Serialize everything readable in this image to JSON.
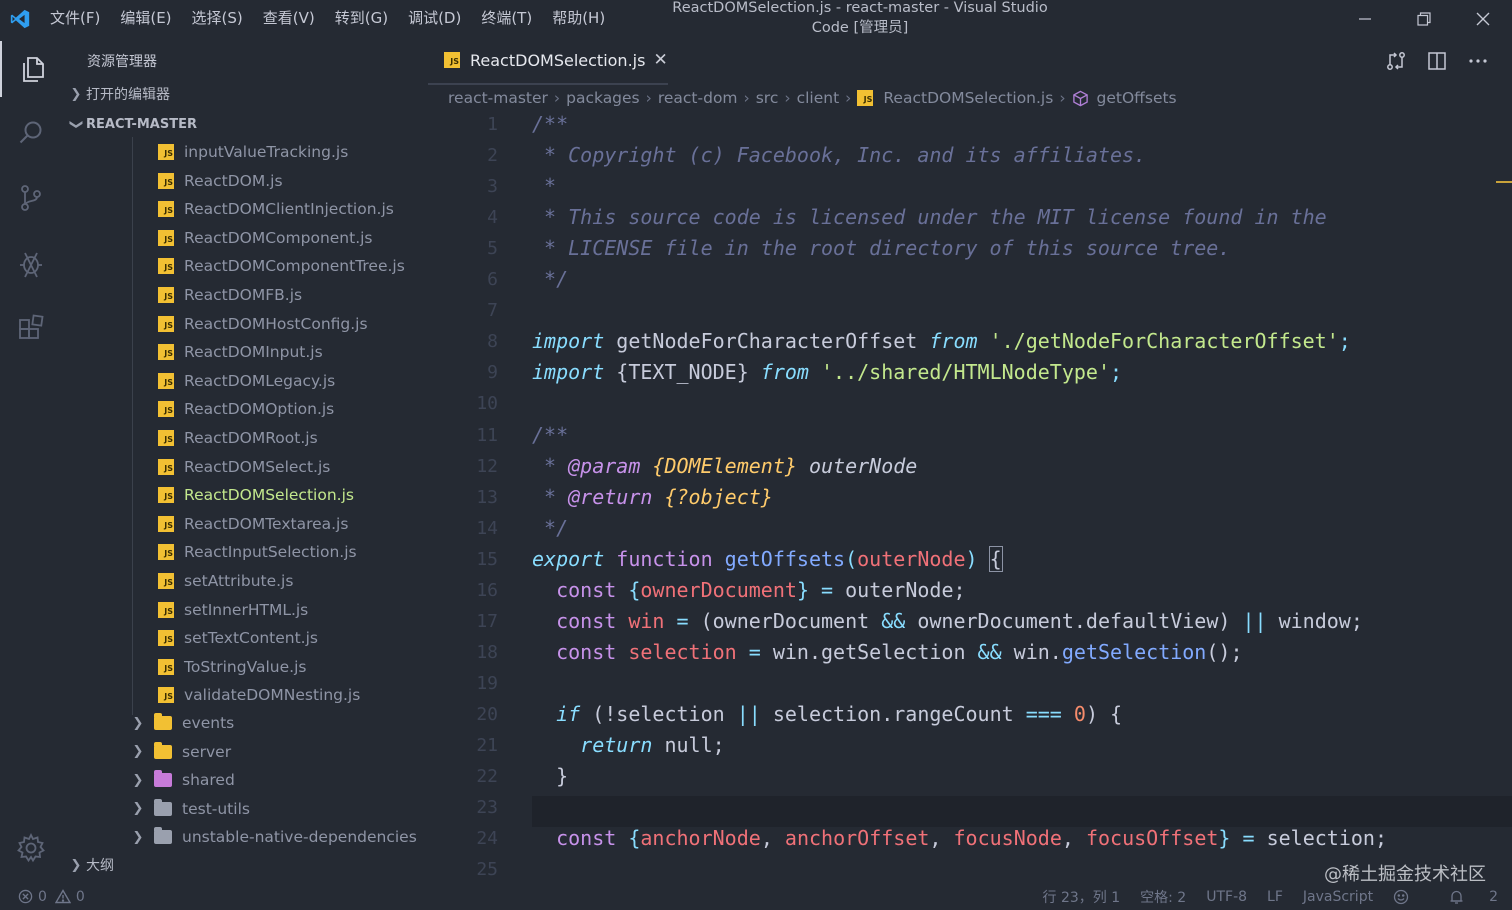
{
  "titlebar": {
    "menu": [
      "文件(F)",
      "编辑(E)",
      "选择(S)",
      "查看(V)",
      "转到(G)",
      "调试(D)",
      "终端(T)",
      "帮助(H)"
    ],
    "title": "ReactDOMSelection.js - react-master - Visual Studio Code [管理员]"
  },
  "activity_bar": [
    "explorer-icon",
    "search-icon",
    "source-control-icon",
    "debug-icon",
    "extensions-icon",
    "settings-gear-icon"
  ],
  "sidebar": {
    "heading": "资源管理器",
    "open_editors": "打开的编辑器",
    "project": "REACT-MASTER",
    "outline": "大纲",
    "files": [
      "inputValueTracking.js",
      "ReactDOM.js",
      "ReactDOMClientInjection.js",
      "ReactDOMComponent.js",
      "ReactDOMComponentTree.js",
      "ReactDOMFB.js",
      "ReactDOMHostConfig.js",
      "ReactDOMInput.js",
      "ReactDOMLegacy.js",
      "ReactDOMOption.js",
      "ReactDOMRoot.js",
      "ReactDOMSelect.js",
      "ReactDOMSelection.js",
      "ReactDOMTextarea.js",
      "ReactInputSelection.js",
      "setAttribute.js",
      "setInnerHTML.js",
      "setTextContent.js",
      "ToStringValue.js",
      "validateDOMNesting.js"
    ],
    "selected_file": "ReactDOMSelection.js",
    "folders": [
      {
        "name": "events",
        "color": "#f2c033"
      },
      {
        "name": "server",
        "color": "#f2c033"
      },
      {
        "name": "shared",
        "color": "#c77bd9"
      },
      {
        "name": "test-utils",
        "color": "#9aa0ae"
      },
      {
        "name": "unstable-native-dependencies",
        "color": "#9aa0ae"
      }
    ]
  },
  "tab": {
    "icon_label": "JS",
    "label": "ReactDOMSelection.js",
    "close": "✕"
  },
  "breadcrumb": [
    "react-master",
    "packages",
    "react-dom",
    "src",
    "client",
    "ReactDOMSelection.js",
    "getOffsets"
  ],
  "editor": {
    "line_numbers": [
      "1",
      "2",
      "3",
      "4",
      "5",
      "6",
      "7",
      "8",
      "9",
      "10",
      "11",
      "12",
      "13",
      "14",
      "15",
      "16",
      "17",
      "18",
      "19",
      "20",
      "21",
      "22",
      "23",
      "24",
      "25"
    ],
    "lines": [
      [
        {
          "t": "/**",
          "c": "com"
        }
      ],
      [
        {
          "t": " * Copyright (c) Facebook, Inc. and its affiliates.",
          "c": "com"
        }
      ],
      [
        {
          "t": " *",
          "c": "com"
        }
      ],
      [
        {
          "t": " * This source code is licensed under the MIT license found in the",
          "c": "com"
        }
      ],
      [
        {
          "t": " * LICENSE file in the root directory of this source tree.",
          "c": "com"
        }
      ],
      [
        {
          "t": " */",
          "c": "com"
        }
      ],
      [],
      [
        {
          "t": "import",
          "c": "kwi"
        },
        {
          "t": " getNodeForCharacterOffset ",
          "c": "txt"
        },
        {
          "t": "from",
          "c": "kwi"
        },
        {
          "t": " ",
          "c": "txt"
        },
        {
          "t": "'./getNodeForCharacterOffset'",
          "c": "str"
        },
        {
          "t": ";",
          "c": "kw"
        }
      ],
      [
        {
          "t": "import",
          "c": "kwi"
        },
        {
          "t": " {TEXT_NODE} ",
          "c": "txt"
        },
        {
          "t": "from",
          "c": "kwi"
        },
        {
          "t": " ",
          "c": "txt"
        },
        {
          "t": "'../shared/HTMLNodeType'",
          "c": "str"
        },
        {
          "t": ";",
          "c": "kw"
        }
      ],
      [],
      [
        {
          "t": "/**",
          "c": "com"
        }
      ],
      [
        {
          "t": " * ",
          "c": "com"
        },
        {
          "t": "@param",
          "c": "tag"
        },
        {
          "t": " ",
          "c": "com"
        },
        {
          "t": "{DOMElement}",
          "c": "typ"
        },
        {
          "t": " outerNode",
          "c": "txtital"
        }
      ],
      [
        {
          "t": " * ",
          "c": "com"
        },
        {
          "t": "@return",
          "c": "tag"
        },
        {
          "t": " ",
          "c": "com"
        },
        {
          "t": "{?object}",
          "c": "typ"
        }
      ],
      [
        {
          "t": " */",
          "c": "com"
        }
      ],
      [
        {
          "t": "export",
          "c": "kwi"
        },
        {
          "t": " ",
          "c": "txt"
        },
        {
          "t": "function",
          "c": "tag2"
        },
        {
          "t": " ",
          "c": "txt"
        },
        {
          "t": "getOffsets",
          "c": "fn"
        },
        {
          "t": "(",
          "c": "kw"
        },
        {
          "t": "outerNode",
          "c": "par"
        },
        {
          "t": ")",
          "c": "kw"
        },
        {
          "t": " ",
          "c": "txt"
        },
        {
          "t": "{",
          "c": "brace"
        }
      ],
      [
        {
          "t": "  const",
          "c": "tag2"
        },
        {
          "t": " {",
          "c": "kw"
        },
        {
          "t": "ownerDocument",
          "c": "var"
        },
        {
          "t": "}",
          "c": "kw"
        },
        {
          "t": " = ",
          "c": "kw"
        },
        {
          "t": "outerNode;",
          "c": "txt"
        }
      ],
      [
        {
          "t": "  const",
          "c": "tag2"
        },
        {
          "t": " ",
          "c": "txt"
        },
        {
          "t": "win",
          "c": "var"
        },
        {
          "t": " = ",
          "c": "kw"
        },
        {
          "t": "(ownerDocument ",
          "c": "txt"
        },
        {
          "t": "&&",
          "c": "kw"
        },
        {
          "t": " ownerDocument.defaultView) ",
          "c": "txt"
        },
        {
          "t": "||",
          "c": "kw"
        },
        {
          "t": " window;",
          "c": "txt"
        }
      ],
      [
        {
          "t": "  const",
          "c": "tag2"
        },
        {
          "t": " ",
          "c": "txt"
        },
        {
          "t": "selection",
          "c": "var"
        },
        {
          "t": " = ",
          "c": "kw"
        },
        {
          "t": "win.getSelection ",
          "c": "txt"
        },
        {
          "t": "&&",
          "c": "kw"
        },
        {
          "t": " win.",
          "c": "txt"
        },
        {
          "t": "getSelection",
          "c": "fn"
        },
        {
          "t": "();",
          "c": "txt"
        }
      ],
      [],
      [
        {
          "t": "  if",
          "c": "kwi"
        },
        {
          "t": " (!selection ",
          "c": "txt"
        },
        {
          "t": "||",
          "c": "kw"
        },
        {
          "t": " selection.rangeCount ",
          "c": "txt"
        },
        {
          "t": "===",
          "c": "kw"
        },
        {
          "t": " ",
          "c": "txt"
        },
        {
          "t": "0",
          "c": "num"
        },
        {
          "t": ") {",
          "c": "txt"
        }
      ],
      [
        {
          "t": "    return",
          "c": "kwi"
        },
        {
          "t": " null;",
          "c": "txt"
        }
      ],
      [
        {
          "t": "  }",
          "c": "txt"
        }
      ],
      [],
      [
        {
          "t": "  const",
          "c": "tag2"
        },
        {
          "t": " {",
          "c": "kw"
        },
        {
          "t": "anchorNode",
          "c": "var"
        },
        {
          "t": ", ",
          "c": "txt"
        },
        {
          "t": "anchorOffset",
          "c": "var"
        },
        {
          "t": ", ",
          "c": "txt"
        },
        {
          "t": "focusNode",
          "c": "var"
        },
        {
          "t": ", ",
          "c": "txt"
        },
        {
          "t": "focusOffset",
          "c": "var"
        },
        {
          "t": "}",
          "c": "kw"
        },
        {
          "t": " = ",
          "c": "kw"
        },
        {
          "t": "selection;",
          "c": "txt"
        }
      ],
      []
    ]
  },
  "statusbar": {
    "errors": "0",
    "warnings": "0",
    "position": "行 23，列 1",
    "spaces": "空格: 2",
    "encoding": "UTF-8",
    "eol": "LF",
    "language": "JavaScript",
    "notifications": "2"
  },
  "watermark": "@稀土掘金技术社区",
  "colors": {
    "background": "#252a33",
    "comment": "#697098",
    "keyword": "#89ddff",
    "string": "#c3e88d",
    "function": "#82aaff",
    "variable": "#f07178",
    "tag": "#c792ea",
    "type": "#ffcb6b",
    "js_icon": "#f2c033"
  }
}
